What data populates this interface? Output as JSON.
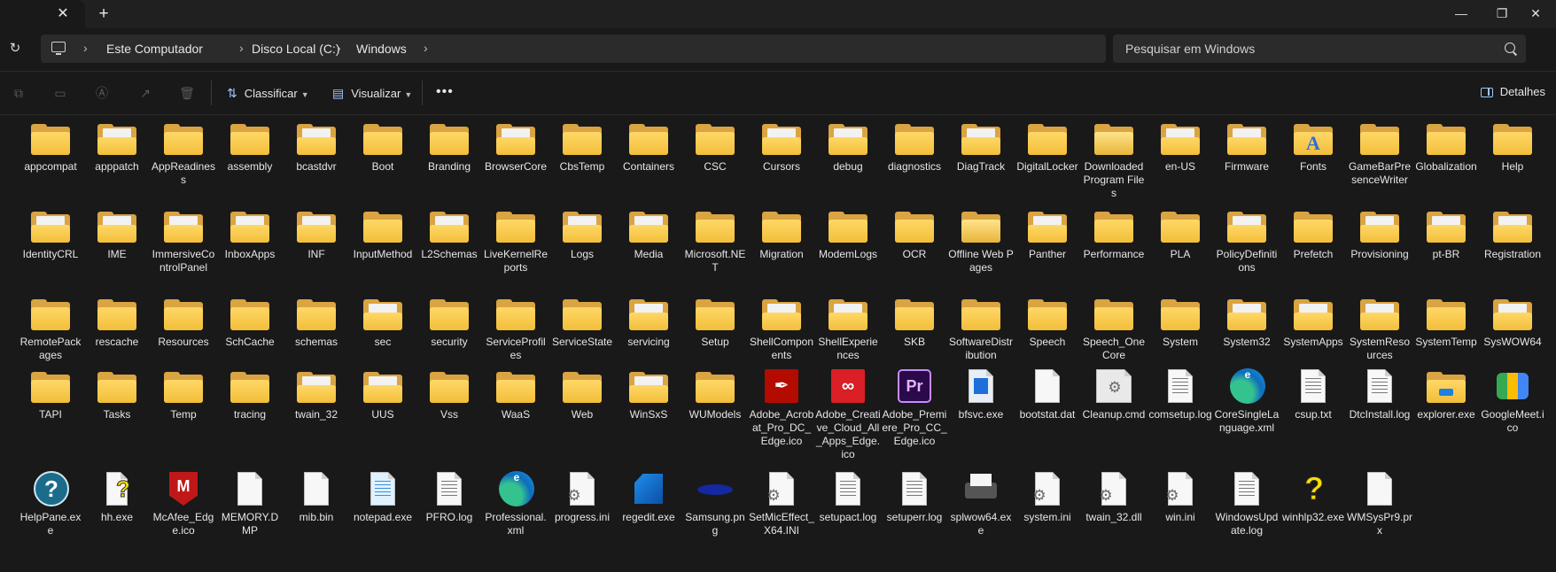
{
  "titlebar": {
    "close_tab": "✕",
    "new_tab": "+",
    "minimize": "—",
    "maximize": "❐",
    "close": "✕"
  },
  "address": {
    "refresh": "↻",
    "crumbs": [
      "Este Computador",
      "Disco Local (C:)",
      "Windows"
    ],
    "chevron": "›",
    "search_placeholder": "Pesquisar em Windows"
  },
  "toolbar": {
    "sort_label": "Classificar",
    "view_label": "Visualizar",
    "more": "•••",
    "details_label": "Detalhes",
    "disabled_icons": [
      "copy-icon",
      "paste-icon",
      "rename-icon",
      "share-icon",
      "delete-icon"
    ]
  },
  "colors": {
    "background": "#191919",
    "folder": "#f2be3a",
    "accent": "#9fc4ff"
  },
  "files": [
    {
      "name": "appcompat",
      "type": "folder"
    },
    {
      "name": "apppatch",
      "type": "folder-content"
    },
    {
      "name": "AppReadiness",
      "type": "folder"
    },
    {
      "name": "assembly",
      "type": "folder"
    },
    {
      "name": "bcastdvr",
      "type": "folder-content"
    },
    {
      "name": "Boot",
      "type": "folder"
    },
    {
      "name": "Branding",
      "type": "folder"
    },
    {
      "name": "BrowserCore",
      "type": "folder-content"
    },
    {
      "name": "CbsTemp",
      "type": "folder"
    },
    {
      "name": "Containers",
      "type": "folder"
    },
    {
      "name": "CSC",
      "type": "folder"
    },
    {
      "name": "Cursors",
      "type": "folder-content"
    },
    {
      "name": "debug",
      "type": "folder-content"
    },
    {
      "name": "diagnostics",
      "type": "folder"
    },
    {
      "name": "DiagTrack",
      "type": "folder-content"
    },
    {
      "name": "DigitalLocker",
      "type": "folder"
    },
    {
      "name": "Downloaded Program Files",
      "type": "folder-special"
    },
    {
      "name": "en-US",
      "type": "folder-content"
    },
    {
      "name": "Firmware",
      "type": "folder-content"
    },
    {
      "name": "Fonts",
      "type": "fonts"
    },
    {
      "name": "GameBarPresenceWriter",
      "type": "folder"
    },
    {
      "name": "Globalization",
      "type": "folder"
    },
    {
      "name": "Help",
      "type": "folder"
    },
    {
      "name": "IdentityCRL",
      "type": "folder-content"
    },
    {
      "name": "IME",
      "type": "folder-content"
    },
    {
      "name": "ImmersiveControlPanel",
      "type": "folder-content"
    },
    {
      "name": "InboxApps",
      "type": "folder-content"
    },
    {
      "name": "INF",
      "type": "folder-content"
    },
    {
      "name": "InputMethod",
      "type": "folder"
    },
    {
      "name": "L2Schemas",
      "type": "folder-content"
    },
    {
      "name": "LiveKernelReports",
      "type": "folder"
    },
    {
      "name": "Logs",
      "type": "folder-content"
    },
    {
      "name": "Media",
      "type": "folder-content"
    },
    {
      "name": "Microsoft.NET",
      "type": "folder"
    },
    {
      "name": "Migration",
      "type": "folder"
    },
    {
      "name": "ModemLogs",
      "type": "folder"
    },
    {
      "name": "OCR",
      "type": "folder"
    },
    {
      "name": "Offline Web Pages",
      "type": "folder-special"
    },
    {
      "name": "Panther",
      "type": "folder-content"
    },
    {
      "name": "Performance",
      "type": "folder"
    },
    {
      "name": "PLA",
      "type": "folder"
    },
    {
      "name": "PolicyDefinitions",
      "type": "folder-content"
    },
    {
      "name": "Prefetch",
      "type": "folder"
    },
    {
      "name": "Provisioning",
      "type": "folder-content"
    },
    {
      "name": "pt-BR",
      "type": "folder-content"
    },
    {
      "name": "Registration",
      "type": "folder-content"
    },
    {
      "name": "RemotePackages",
      "type": "folder"
    },
    {
      "name": "rescache",
      "type": "folder"
    },
    {
      "name": "Resources",
      "type": "folder"
    },
    {
      "name": "SchCache",
      "type": "folder"
    },
    {
      "name": "schemas",
      "type": "folder"
    },
    {
      "name": "sec",
      "type": "folder-content"
    },
    {
      "name": "security",
      "type": "folder"
    },
    {
      "name": "ServiceProfiles",
      "type": "folder"
    },
    {
      "name": "ServiceState",
      "type": "folder"
    },
    {
      "name": "servicing",
      "type": "folder-content"
    },
    {
      "name": "Setup",
      "type": "folder"
    },
    {
      "name": "ShellComponents",
      "type": "folder-content"
    },
    {
      "name": "ShellExperiences",
      "type": "folder-content"
    },
    {
      "name": "SKB",
      "type": "folder"
    },
    {
      "name": "SoftwareDistribution",
      "type": "folder"
    },
    {
      "name": "Speech",
      "type": "folder"
    },
    {
      "name": "Speech_OneCore",
      "type": "folder"
    },
    {
      "name": "System",
      "type": "folder"
    },
    {
      "name": "System32",
      "type": "folder-content"
    },
    {
      "name": "SystemApps",
      "type": "folder-content"
    },
    {
      "name": "SystemResources",
      "type": "folder-content"
    },
    {
      "name": "SystemTemp",
      "type": "folder"
    },
    {
      "name": "SysWOW64",
      "type": "folder-content"
    },
    {
      "name": "TAPI",
      "type": "folder"
    },
    {
      "name": "Tasks",
      "type": "folder"
    },
    {
      "name": "Temp",
      "type": "folder"
    },
    {
      "name": "tracing",
      "type": "folder"
    },
    {
      "name": "twain_32",
      "type": "folder-content"
    },
    {
      "name": "UUS",
      "type": "folder-content"
    },
    {
      "name": "Vss",
      "type": "folder"
    },
    {
      "name": "WaaS",
      "type": "folder"
    },
    {
      "name": "Web",
      "type": "folder"
    },
    {
      "name": "WinSxS",
      "type": "folder-content"
    },
    {
      "name": "WUModels",
      "type": "folder"
    },
    {
      "name": "Adobe_Acrobat_Pro_DC_Edge.ico",
      "type": "acrobat"
    },
    {
      "name": "Adobe_Creative_Cloud_All_Apps_Edge.ico",
      "type": "creative-cloud"
    },
    {
      "name": "Adobe_Premiere_Pro_CC_Edge.ico",
      "type": "premiere"
    },
    {
      "name": "bfsvc.exe",
      "type": "exe-blue"
    },
    {
      "name": "bootstat.dat",
      "type": "doc-blank"
    },
    {
      "name": "Cleanup.cmd",
      "type": "cmd"
    },
    {
      "name": "comsetup.log",
      "type": "doc-lines"
    },
    {
      "name": "CoreSingleLanguage.xml",
      "type": "edge"
    },
    {
      "name": "csup.txt",
      "type": "doc-lines"
    },
    {
      "name": "DtcInstall.log",
      "type": "doc-lines"
    },
    {
      "name": "explorer.exe",
      "type": "explorer"
    },
    {
      "name": "GoogleMeet.ico",
      "type": "meet"
    },
    {
      "name": "HelpPane.exe",
      "type": "help"
    },
    {
      "name": "hh.exe",
      "type": "hh"
    },
    {
      "name": "McAfee_Edge.ico",
      "type": "mcafee"
    },
    {
      "name": "MEMORY.DMP",
      "type": "doc-blank"
    },
    {
      "name": "mib.bin",
      "type": "doc-blank"
    },
    {
      "name": "notepad.exe",
      "type": "notepad"
    },
    {
      "name": "PFRO.log",
      "type": "doc-lines"
    },
    {
      "name": "Professional.xml",
      "type": "edge"
    },
    {
      "name": "progress.ini",
      "type": "doc-gear"
    },
    {
      "name": "regedit.exe",
      "type": "regedit"
    },
    {
      "name": "Samsung.png",
      "type": "samsung"
    },
    {
      "name": "SetMicEffect_X64.INI",
      "type": "doc-gear"
    },
    {
      "name": "setupact.log",
      "type": "doc-lines"
    },
    {
      "name": "setuperr.log",
      "type": "doc-lines"
    },
    {
      "name": "splwow64.exe",
      "type": "printer"
    },
    {
      "name": "system.ini",
      "type": "doc-gear"
    },
    {
      "name": "twain_32.dll",
      "type": "doc-gear"
    },
    {
      "name": "win.ini",
      "type": "doc-gear"
    },
    {
      "name": "WindowsUpdate.log",
      "type": "doc-lines"
    },
    {
      "name": "winhlp32.exe",
      "type": "winhlp"
    },
    {
      "name": "WMSysPr9.prx",
      "type": "doc-blank"
    }
  ]
}
